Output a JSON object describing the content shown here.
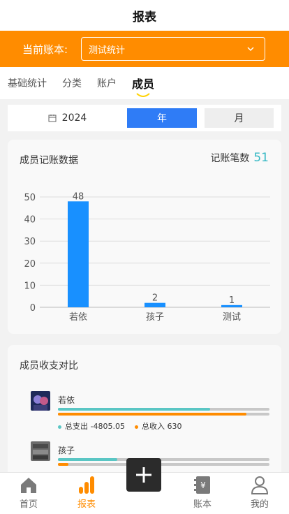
{
  "header": {
    "title": "报表"
  },
  "ledger": {
    "label": "当前账本:",
    "selected": "测试统计"
  },
  "tabs": [
    {
      "label": "基础统计"
    },
    {
      "label": "分类"
    },
    {
      "label": "账户"
    },
    {
      "label": "成员",
      "active": true
    }
  ],
  "period": {
    "year": "2024",
    "year_button": "年",
    "month_button": "月",
    "selected": "年"
  },
  "member_card": {
    "title": "成员记账数据",
    "count_label": "记账笔数",
    "count_value": "51"
  },
  "chart_data": {
    "type": "bar",
    "categories": [
      "若依",
      "孩子",
      "测试"
    ],
    "values": [
      48,
      2,
      1
    ],
    "ylim": [
      0,
      50
    ],
    "yticks": [
      0,
      10,
      20,
      30,
      40,
      50
    ],
    "grid": true,
    "bar_color": "#1890ff"
  },
  "compare_card": {
    "title": "成员收支对比",
    "members": [
      {
        "name": "若依",
        "expense_label": "总支出 -4805.05",
        "income_label": "总收入 630",
        "expense_ratio": 0.72,
        "income_ratio": 0.89
      },
      {
        "name": "孩子",
        "expense_ratio": 0.28,
        "income_ratio": 0.05
      }
    ]
  },
  "tabbar": {
    "items": [
      {
        "label": "首页",
        "icon": "home-icon"
      },
      {
        "label": "报表",
        "icon": "chart-icon",
        "active": true
      },
      {
        "label": "账本",
        "icon": "ledger-icon"
      },
      {
        "label": "我的",
        "icon": "user-icon"
      }
    ],
    "add_icon": "plus-icon"
  },
  "colors": {
    "accent": "#ff8c00",
    "primary": "#2f7cf6",
    "expense": "#5ac6c4",
    "income": "#ff8c00"
  }
}
